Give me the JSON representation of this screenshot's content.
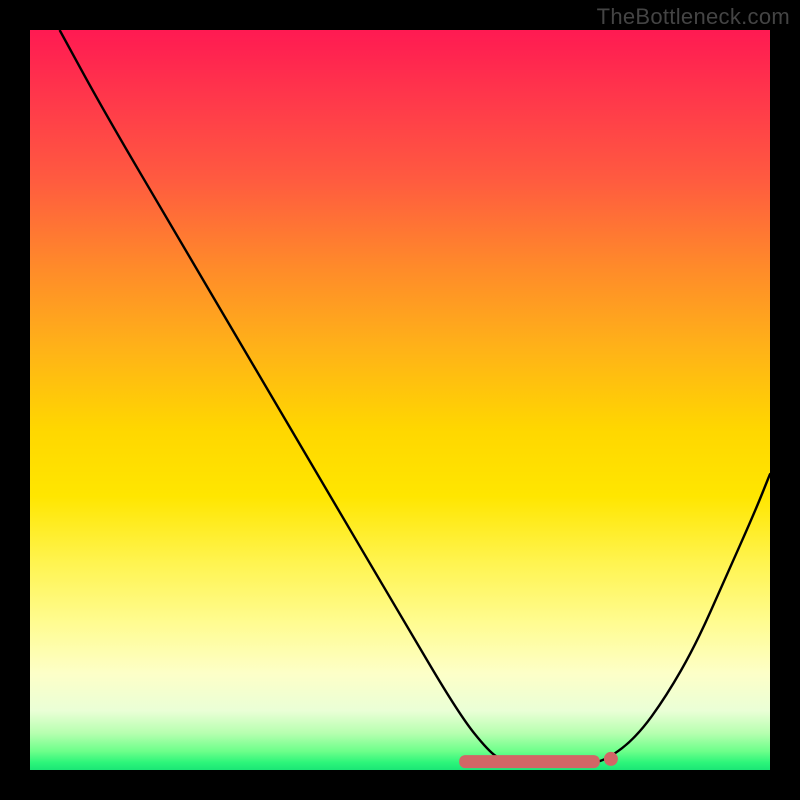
{
  "watermark": "TheBottleneck.com",
  "colors": {
    "curve": "#000000",
    "marker": "#d26666",
    "background_black": "#000000"
  },
  "chart_data": {
    "type": "line",
    "title": "",
    "xlabel": "",
    "ylabel": "",
    "xlim": [
      0,
      100
    ],
    "ylim": [
      0,
      100
    ],
    "grid": false,
    "legend": "none",
    "notes": "Bottleneck-style V-curve on rainbow gradient background. Axes and ticks are not shown. Values in series[0] are visual estimates read from pixel positions (no axis labels present).",
    "series": [
      {
        "name": "bottleneck-curve",
        "color": "#000000",
        "x": [
          4,
          10,
          20,
          30,
          40,
          50,
          58,
          62,
          64,
          66,
          68,
          72,
          75,
          78,
          82,
          86,
          90,
          94,
          98,
          100
        ],
        "y": [
          100,
          89,
          72,
          55,
          38,
          21,
          7.5,
          2.5,
          1.2,
          0.7,
          0.6,
          0.6,
          0.7,
          1.4,
          4.5,
          10,
          17,
          26,
          35,
          40
        ]
      }
    ],
    "flat_marker": {
      "comment": "salmon rounded-rect highlighting the flat bottom of the curve",
      "x_start": 58,
      "x_end": 77,
      "y": 1.2,
      "dot_x": 78.5,
      "dot_y": 1.5,
      "color": "#d26666"
    }
  }
}
